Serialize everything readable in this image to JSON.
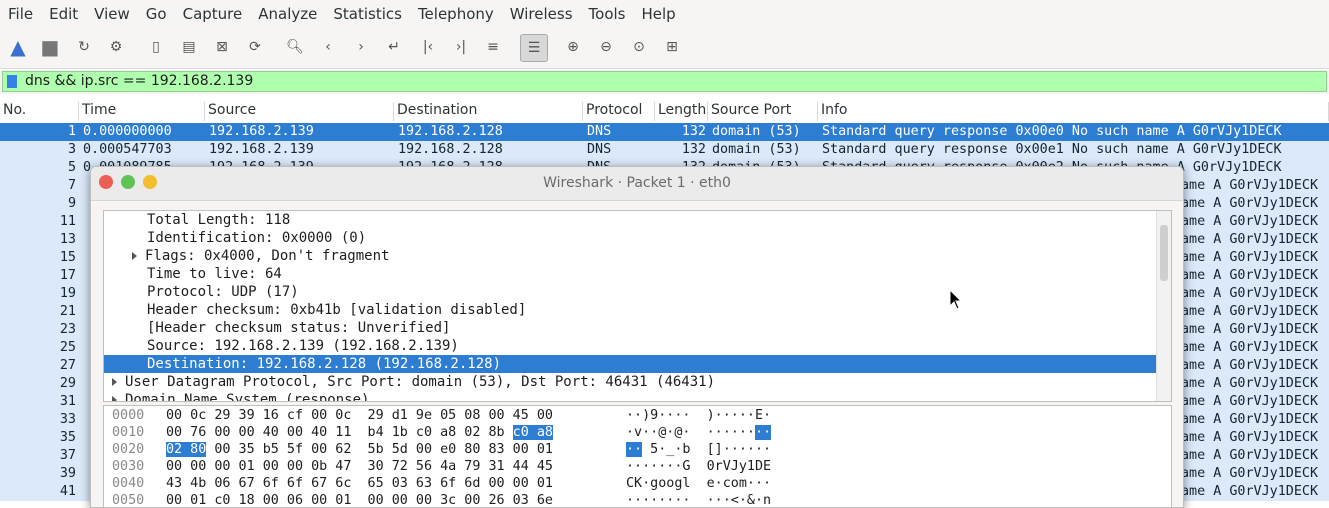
{
  "menu": [
    "File",
    "Edit",
    "View",
    "Go",
    "Capture",
    "Analyze",
    "Statistics",
    "Telephony",
    "Wireless",
    "Tools",
    "Help"
  ],
  "toolbar_icons": [
    "shark-fin-icon",
    "stop-icon",
    "restart-icon",
    "gear-icon",
    "open-file-icon",
    "save-file-icon",
    "close-file-icon",
    "reload-icon",
    "search-icon",
    "back-icon",
    "forward-icon",
    "goto-icon",
    "first-packet-icon",
    "last-packet-icon",
    "autoscroll-icon",
    "colorize-icon",
    "zoom-in-icon",
    "zoom-out-icon",
    "zoom-normal-icon",
    "resize-columns-icon"
  ],
  "filter": {
    "text": "dns && ip.src == 192.168.2.139"
  },
  "columns": [
    "No.",
    "Time",
    "Source",
    "Destination",
    "Protocol",
    "Length",
    "Source Port",
    "Info"
  ],
  "packets": [
    {
      "no": "1",
      "time": "0.000000000",
      "src": "192.168.2.139",
      "dst": "192.168.2.128",
      "proto": "DNS",
      "len": "132",
      "sport": "domain (53)",
      "info": "Standard query response 0x00e0 No such name A G0rVJy1DECK"
    },
    {
      "no": "3",
      "time": "0.000547703",
      "src": "192.168.2.139",
      "dst": "192.168.2.128",
      "proto": "DNS",
      "len": "132",
      "sport": "domain (53)",
      "info": "Standard query response 0x00e1 No such name A G0rVJy1DECK"
    },
    {
      "no": "5",
      "time": "0.001089785",
      "src": "192.168.2.139",
      "dst": "192.168.2.128",
      "proto": "DNS",
      "len": "132",
      "sport": "domain (53)",
      "info": "Standard query response 0x00e2 No such name A G0rVJy1DECK"
    },
    {
      "no": "7",
      "info": "ame A G0rVJy1DECK"
    },
    {
      "no": "9",
      "info": "ame A G0rVJy1DECK"
    },
    {
      "no": "11",
      "info": "ame A G0rVJy1DECK"
    },
    {
      "no": "13",
      "info": "ame A G0rVJy1DECK"
    },
    {
      "no": "15",
      "info": "ame A G0rVJy1DECK"
    },
    {
      "no": "17",
      "info": "ame A G0rVJy1DECK"
    },
    {
      "no": "19",
      "info": "ame A G0rVJy1DECK"
    },
    {
      "no": "21",
      "info": "ame A G0rVJy1DECK"
    },
    {
      "no": "23",
      "info": "ame A G0rVJy1DECK"
    },
    {
      "no": "25",
      "info": "ame A G0rVJy1DECK"
    },
    {
      "no": "27",
      "info": "ame A G0rVJy1DECK"
    },
    {
      "no": "29",
      "info": "ame A G0rVJy1DECK"
    },
    {
      "no": "31",
      "info": "ame A G0rVJy1DECK"
    },
    {
      "no": "33",
      "info": "ame A G0rVJy1DECK"
    },
    {
      "no": "35",
      "info": "ame A G0rVJy1DECK"
    },
    {
      "no": "37",
      "info": "ame A G0rVJy1DECK"
    },
    {
      "no": "39",
      "info": "ame A G0rVJy1DECK"
    },
    {
      "no": "41",
      "info": "ame A G0rVJy1DECK"
    }
  ],
  "dialog": {
    "title": "Wireshark · Packet 1 · eth0",
    "tree": [
      {
        "text": "Total Length: 118",
        "indent": 2,
        "arrow": false,
        "sel": false
      },
      {
        "text": "Identification: 0x0000 (0)",
        "indent": 2,
        "arrow": false,
        "sel": false
      },
      {
        "text": "Flags: 0x4000, Don't fragment",
        "indent": 2,
        "arrow": true,
        "sel": false
      },
      {
        "text": "Time to live: 64",
        "indent": 2,
        "arrow": false,
        "sel": false
      },
      {
        "text": "Protocol: UDP (17)",
        "indent": 2,
        "arrow": false,
        "sel": false
      },
      {
        "text": "Header checksum: 0xb41b [validation disabled]",
        "indent": 2,
        "arrow": false,
        "sel": false
      },
      {
        "text": "[Header checksum status: Unverified]",
        "indent": 2,
        "arrow": false,
        "sel": false
      },
      {
        "text": "Source: 192.168.2.139 (192.168.2.139)",
        "indent": 2,
        "arrow": false,
        "sel": false
      },
      {
        "text": "Destination: 192.168.2.128 (192.168.2.128)",
        "indent": 2,
        "arrow": false,
        "sel": true
      },
      {
        "text": "User Datagram Protocol, Src Port: domain (53), Dst Port: 46431 (46431)",
        "indent": 1,
        "arrow": true,
        "sel": false
      },
      {
        "text": "Domain Name System (response)",
        "indent": 1,
        "arrow": true,
        "sel": false
      }
    ],
    "hex": [
      {
        "off": "0000",
        "bytes": "00 0c 29 39 16 cf 00 0c  29 d1 9e 05 08 00 45 00",
        "ascii": "··)9····  )·····E·"
      },
      {
        "off": "0010",
        "bytes": "00 76 00 00 40 00 40 11  b4 1b c0 a8 02 8b c0 a8",
        "ascii": "·v··@·@·  ········"
      },
      {
        "off": "0020",
        "bytes": "02 80 00 35 b5 5f 00 62  5b 5d 00 e0 80 83 00 01",
        "ascii": "·· 5·_·b  []······"
      },
      {
        "off": "0030",
        "bytes": "00 00 00 01 00 00 0b 47  30 72 56 4a 79 31 44 45",
        "ascii": "·······G  0rVJy1DE"
      },
      {
        "off": "0040",
        "bytes": "43 4b 06 67 6f 6f 67 6c  65 03 63 6f 6d 00 00 01",
        "ascii": "CK·googl  e·com···"
      },
      {
        "off": "0050",
        "bytes": "00 01 c0 18 00 06 00 01  00 00 00 3c 00 26 03 6e",
        "ascii": "········  ···<·&·n"
      }
    ]
  }
}
